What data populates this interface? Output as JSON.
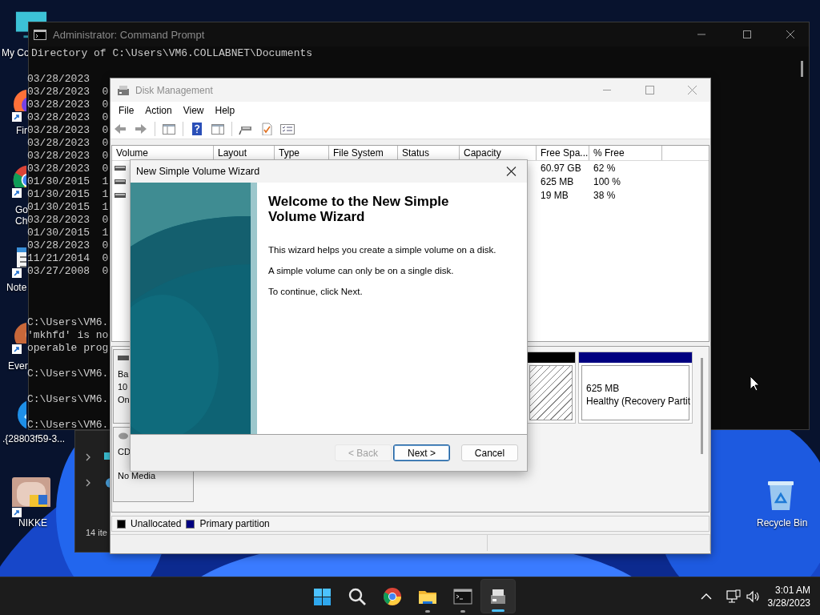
{
  "desktop": {
    "icons": [
      {
        "kind": "computer",
        "label": "My Co",
        "shortcut": false
      },
      {
        "kind": "firefox",
        "label": "Fir",
        "shortcut": true
      },
      {
        "kind": "chrome",
        "label": "Go Ch",
        "shortcut": true
      },
      {
        "kind": "notepad",
        "label": "Note",
        "shortcut": true
      },
      {
        "kind": "evernote",
        "label": "Ever",
        "shortcut": true
      },
      {
        "kind": "bird",
        "label": ".{28803f59-3...",
        "shortcut": false
      },
      {
        "kind": "game",
        "label": "NIKKE",
        "shortcut": true
      },
      {
        "kind": "recycle",
        "label": "Recycle Bin",
        "shortcut": false
      }
    ]
  },
  "command_prompt": {
    "title": "Administrator: Command Prompt",
    "header": "Directory of C:\\Users\\VM6.COLLABNET\\Documents",
    "listing": [
      "03/28/2023",
      "03/28/2023  0",
      "03/28/2023  0",
      "03/28/2023  0",
      "03/28/2023  0",
      "03/28/2023  0",
      "03/28/2023  0",
      "03/28/2023  0",
      "01/30/2015  1",
      "01/30/2015  1",
      "01/30/2015  1",
      "03/28/2023  0",
      "01/30/2015  1",
      "03/28/2023  0",
      "11/21/2014  0",
      "03/27/2008  0"
    ],
    "output": [
      {
        "lines": [
          "C:\\Users\\VM6.",
          "'mkhfd' is no",
          "operable prog"
        ]
      },
      {
        "lines": [
          "C:\\Users\\VM6."
        ]
      },
      {
        "lines": [
          "C:\\Users\\VM6."
        ]
      },
      {
        "lines": [
          "C:\\Users\\VM6."
        ]
      }
    ]
  },
  "explorer": {
    "status": "14 ite"
  },
  "disk_management": {
    "title": "Disk Management",
    "menu": [
      "File",
      "Action",
      "View",
      "Help"
    ],
    "columns": [
      "Volume",
      "Layout",
      "Type",
      "File System",
      "Status",
      "Capacity",
      "Free Spa...",
      "% Free"
    ],
    "rows": [
      {
        "free_space": "60.97 GB",
        "percent_free": "62 %"
      },
      {
        "free_space": "625 MB",
        "percent_free": "100 %"
      },
      {
        "free_space": "19 MB",
        "percent_free": "38 %"
      }
    ],
    "disks": [
      {
        "label_lines": [
          "Ba",
          "10",
          "On"
        ],
        "partitions": [
          {
            "kind": "unallocated",
            "color": "#000000"
          },
          {
            "kind": "primary",
            "color": "#000080",
            "size": "625 MB",
            "status": "Healthy (Recovery Partit"
          }
        ]
      },
      {
        "label_lines": [
          "CD"
        ],
        "media": "No Media"
      }
    ],
    "legend": [
      {
        "label": "Unallocated",
        "color": "#000000"
      },
      {
        "label": "Primary partition",
        "color": "#000080"
      }
    ]
  },
  "wizard": {
    "title": "New Simple Volume Wizard",
    "heading": "Welcome to the New Simple Volume Wizard",
    "paragraphs": [
      "This wizard helps you create a simple volume on a disk.",
      "A simple volume can only be on a single disk.",
      "To continue, click Next."
    ],
    "buttons": [
      {
        "label": "< Back",
        "disabled": true,
        "default": false
      },
      {
        "label": "Next >",
        "disabled": false,
        "default": true
      },
      {
        "label": "Cancel",
        "disabled": false,
        "default": false
      }
    ]
  },
  "taskbar": {
    "apps": [
      {
        "kind": "start",
        "running": false,
        "selected": false
      },
      {
        "kind": "search",
        "running": false,
        "selected": false
      },
      {
        "kind": "chrome",
        "running": false,
        "selected": false
      },
      {
        "kind": "folder",
        "running": true,
        "selected": false
      },
      {
        "kind": "terminal",
        "running": true,
        "selected": false
      },
      {
        "kind": "diskmgmt",
        "running": true,
        "selected": true
      }
    ],
    "time": "3:01 AM",
    "date": "3/28/2023"
  }
}
